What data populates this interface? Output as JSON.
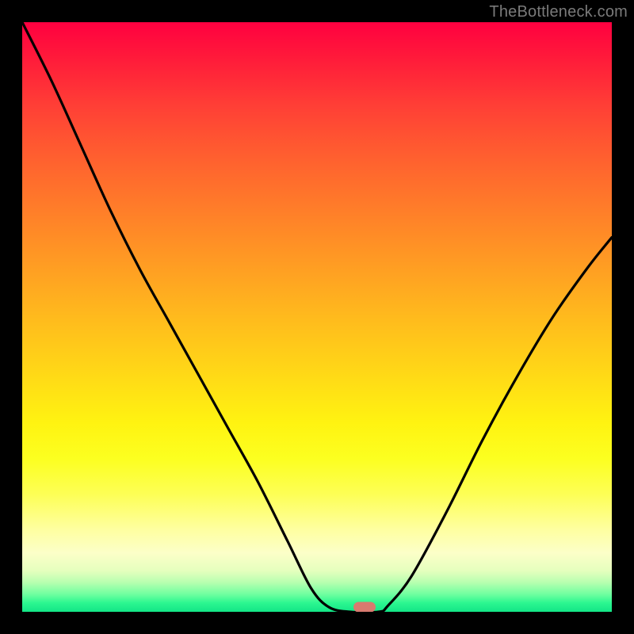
{
  "watermark": {
    "text": "TheBottleneck.com"
  },
  "chart_data": {
    "type": "line",
    "title": "",
    "xlabel": "",
    "ylabel": "",
    "xlim": [
      0,
      1
    ],
    "ylim": [
      0,
      1
    ],
    "background_gradient": {
      "orientation": "vertical",
      "stops": [
        {
          "pos": 0.0,
          "color": "#ff0040"
        },
        {
          "pos": 0.5,
          "color": "#ffba1d"
        },
        {
          "pos": 0.8,
          "color": "#fdff55"
        },
        {
          "pos": 0.93,
          "color": "#e6ffbe"
        },
        {
          "pos": 1.0,
          "color": "#13e587"
        }
      ]
    },
    "series": [
      {
        "name": "curve",
        "color": "#000000",
        "x": [
          0.0,
          0.05,
          0.1,
          0.15,
          0.2,
          0.25,
          0.3,
          0.35,
          0.4,
          0.45,
          0.49,
          0.52,
          0.555,
          0.605,
          0.62,
          0.66,
          0.72,
          0.78,
          0.84,
          0.9,
          0.96,
          1.0
        ],
        "y": [
          1.0,
          0.9,
          0.79,
          0.68,
          0.58,
          0.49,
          0.4,
          0.31,
          0.22,
          0.12,
          0.04,
          0.008,
          0.0,
          0.0,
          0.01,
          0.06,
          0.17,
          0.29,
          0.4,
          0.5,
          0.585,
          0.635
        ]
      }
    ],
    "marker": {
      "x": 0.58,
      "y": 0.0,
      "color": "#d87a6f"
    }
  }
}
